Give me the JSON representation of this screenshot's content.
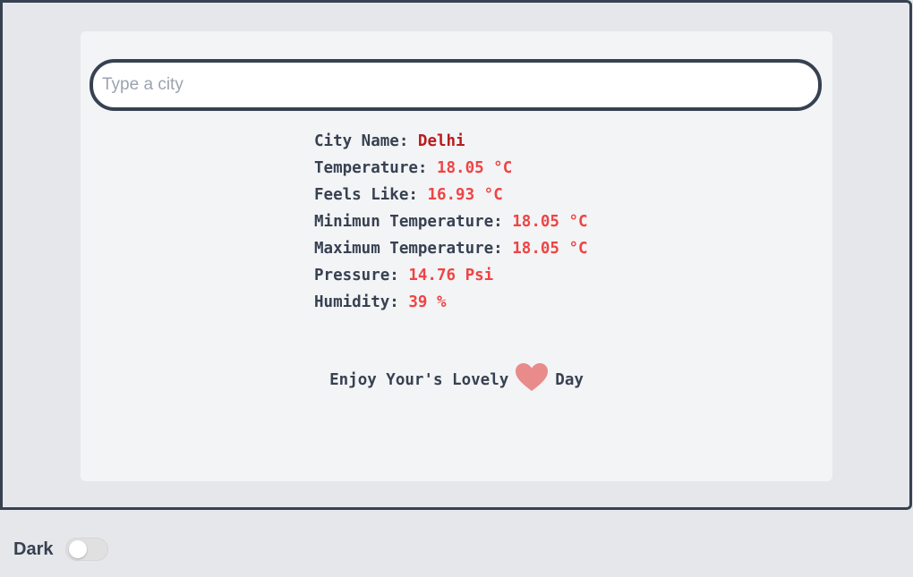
{
  "search": {
    "placeholder": "Type a city",
    "value": ""
  },
  "weather": {
    "items": [
      {
        "label": "City Name: ",
        "value": "Delhi"
      },
      {
        "label": "Temperature: ",
        "value": "18.05 °C"
      },
      {
        "label": "Feels Like: ",
        "value": "16.93 °C"
      },
      {
        "label": "Minimun Temperature: ",
        "value": "18.05 °C"
      },
      {
        "label": "Maximum Temperature: ",
        "value": "18.05 °C"
      },
      {
        "label": "Pressure: ",
        "value": "14.76 Psi"
      },
      {
        "label": "Humidity: ",
        "value": "39 %"
      }
    ]
  },
  "greeting": {
    "before": "Enjoy Your's Lovely",
    "icon": "heart-icon",
    "after": "Day"
  },
  "theme": {
    "label": "Dark",
    "enabled": false
  },
  "colors": {
    "border": "#374151",
    "value_accent": "#ef4444",
    "city_accent": "#b91c1c",
    "heart": "#e98b8b"
  }
}
